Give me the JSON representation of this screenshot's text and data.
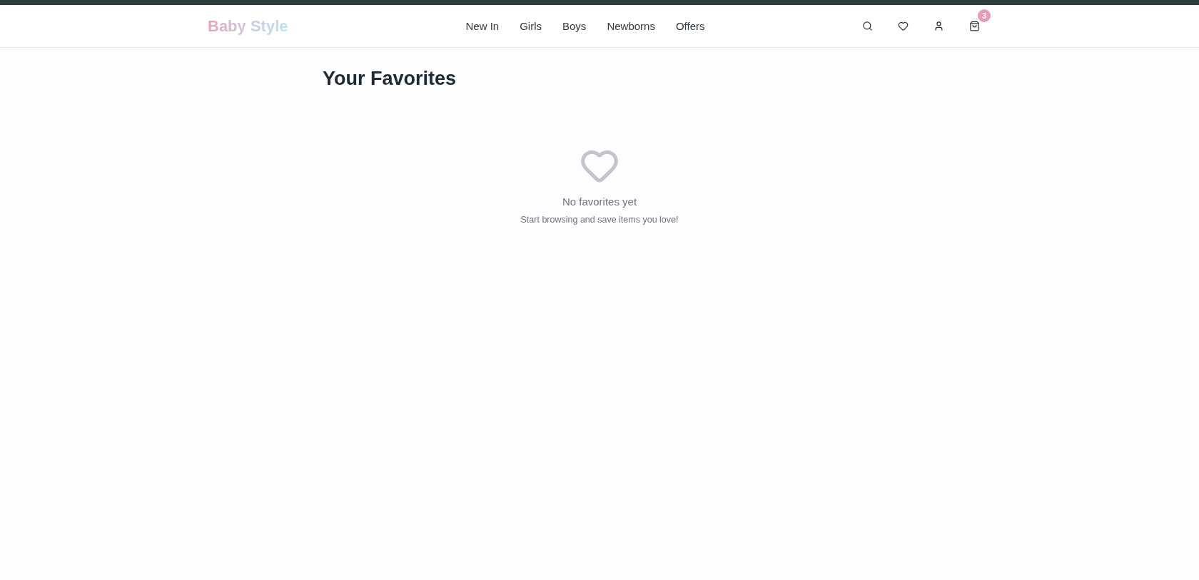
{
  "header": {
    "logo": "Baby Style",
    "nav": [
      {
        "label": "New In"
      },
      {
        "label": "Girls"
      },
      {
        "label": "Boys"
      },
      {
        "label": "Newborns"
      },
      {
        "label": "Offers"
      }
    ],
    "cart_count": "3"
  },
  "page": {
    "title": "Your Favorites",
    "empty_state": {
      "heading": "No favorites yet",
      "message": "Start browsing and save items you love!"
    }
  }
}
